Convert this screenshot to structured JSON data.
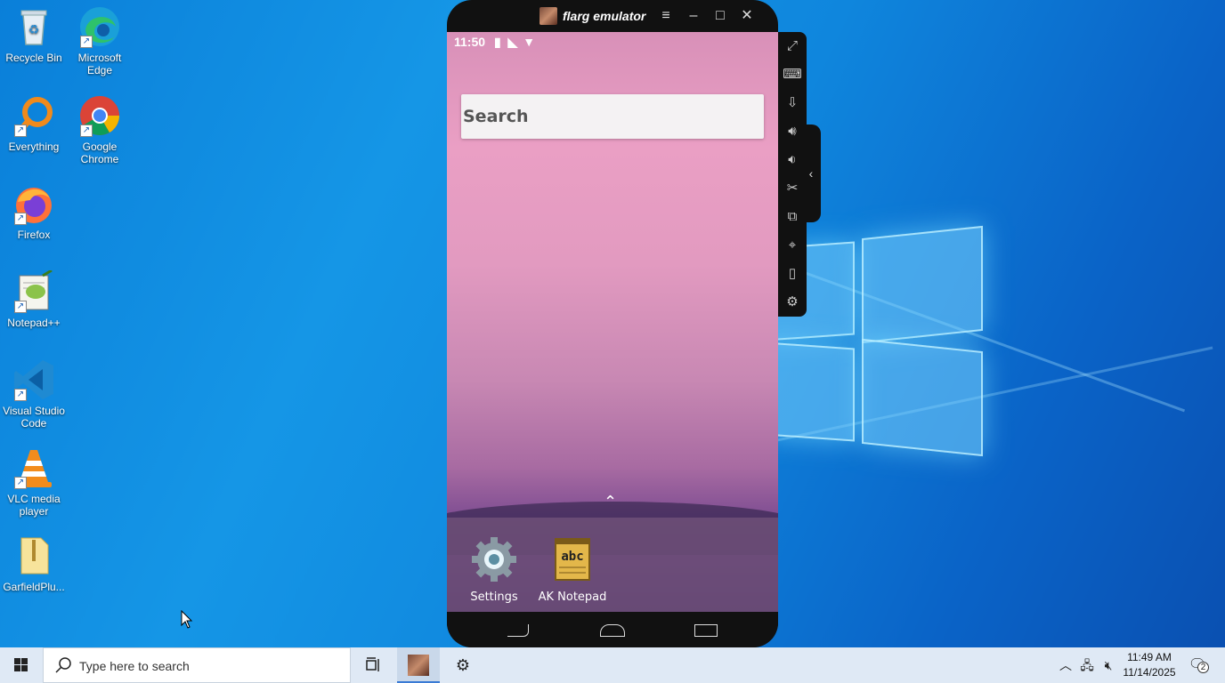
{
  "desktop": {
    "icons": [
      {
        "label": "Recycle Bin"
      },
      {
        "label": "Microsoft Edge"
      },
      {
        "label": "Everything"
      },
      {
        "label": "Google Chrome"
      },
      {
        "label": "Firefox"
      },
      {
        "label": "Notepad++"
      },
      {
        "label": "Visual Studio Code"
      },
      {
        "label": "VLC media player"
      },
      {
        "label": "GarfieldPlu..."
      }
    ]
  },
  "emulator": {
    "title": "flarg emulator",
    "status_time": "11:50",
    "search_placeholder": "Search",
    "dock_apps": [
      {
        "label": "Settings"
      },
      {
        "label": "AK Notepad"
      }
    ]
  },
  "taskbar": {
    "search_placeholder": "Type here to search",
    "time": "11:49 AM",
    "date": "11/14/2025",
    "notification_count": "2"
  }
}
